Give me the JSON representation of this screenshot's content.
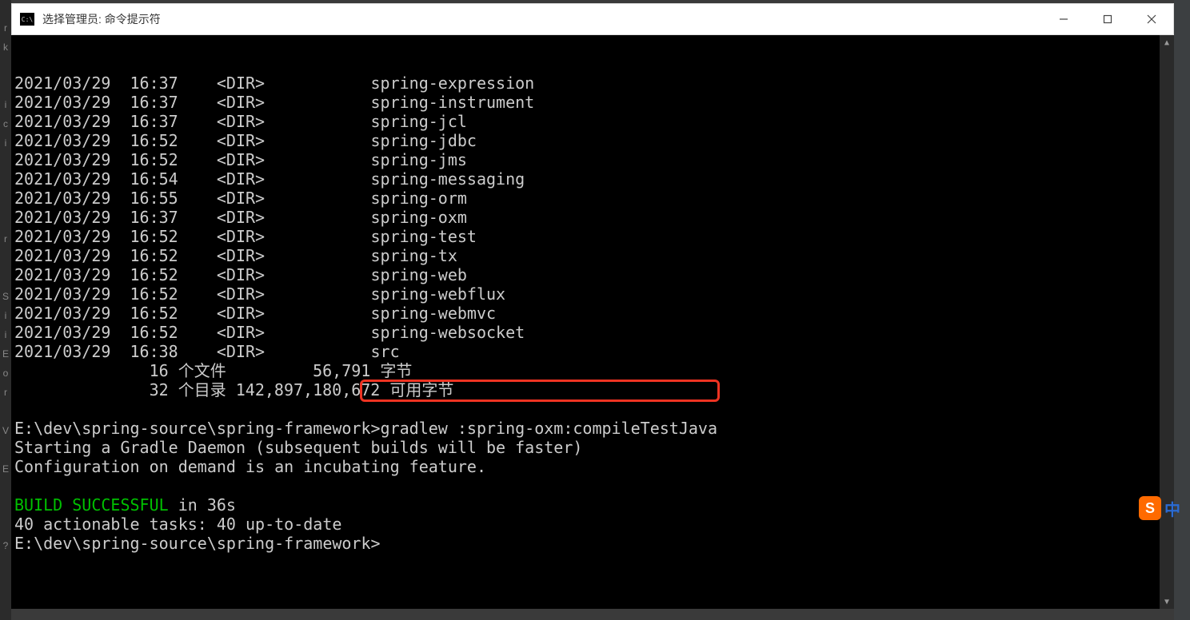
{
  "window": {
    "title": "选择管理员: 命令提示符",
    "icon_text": "C:\\"
  },
  "dir_listing": [
    {
      "date": "2021/03/29",
      "time": "16:37",
      "type": "<DIR>",
      "name": "spring-expression"
    },
    {
      "date": "2021/03/29",
      "time": "16:37",
      "type": "<DIR>",
      "name": "spring-instrument"
    },
    {
      "date": "2021/03/29",
      "time": "16:37",
      "type": "<DIR>",
      "name": "spring-jcl"
    },
    {
      "date": "2021/03/29",
      "time": "16:52",
      "type": "<DIR>",
      "name": "spring-jdbc"
    },
    {
      "date": "2021/03/29",
      "time": "16:52",
      "type": "<DIR>",
      "name": "spring-jms"
    },
    {
      "date": "2021/03/29",
      "time": "16:54",
      "type": "<DIR>",
      "name": "spring-messaging"
    },
    {
      "date": "2021/03/29",
      "time": "16:55",
      "type": "<DIR>",
      "name": "spring-orm"
    },
    {
      "date": "2021/03/29",
      "time": "16:37",
      "type": "<DIR>",
      "name": "spring-oxm"
    },
    {
      "date": "2021/03/29",
      "time": "16:52",
      "type": "<DIR>",
      "name": "spring-test"
    },
    {
      "date": "2021/03/29",
      "time": "16:52",
      "type": "<DIR>",
      "name": "spring-tx"
    },
    {
      "date": "2021/03/29",
      "time": "16:52",
      "type": "<DIR>",
      "name": "spring-web"
    },
    {
      "date": "2021/03/29",
      "time": "16:52",
      "type": "<DIR>",
      "name": "spring-webflux"
    },
    {
      "date": "2021/03/29",
      "time": "16:52",
      "type": "<DIR>",
      "name": "spring-webmvc"
    },
    {
      "date": "2021/03/29",
      "time": "16:52",
      "type": "<DIR>",
      "name": "spring-websocket"
    },
    {
      "date": "2021/03/29",
      "time": "16:38",
      "type": "<DIR>",
      "name": "src"
    }
  ],
  "dir_summary": {
    "files_line": "              16 个文件         56,791 字节",
    "dirs_line": "              32 个目录 142,897,180,672 可用字节"
  },
  "session": {
    "prompt_path": "E:\\dev\\spring-source\\spring-framework>",
    "command": "gradlew :spring-oxm:compileTestJava",
    "line_daemon": "Starting a Gradle Daemon (subsequent builds will be faster)",
    "line_config": "Configuration on demand is an incubating feature.",
    "build_success": "BUILD SUCCESSFUL",
    "build_time": " in 36s",
    "actionable": "40 actionable tasks: 40 up-to-date",
    "prompt2": "E:\\dev\\spring-source\\spring-framework>"
  },
  "ime": {
    "s": "S",
    "cn": "中"
  },
  "gutter_chars": "rk  ici    r  SiiEor V E   ?  "
}
